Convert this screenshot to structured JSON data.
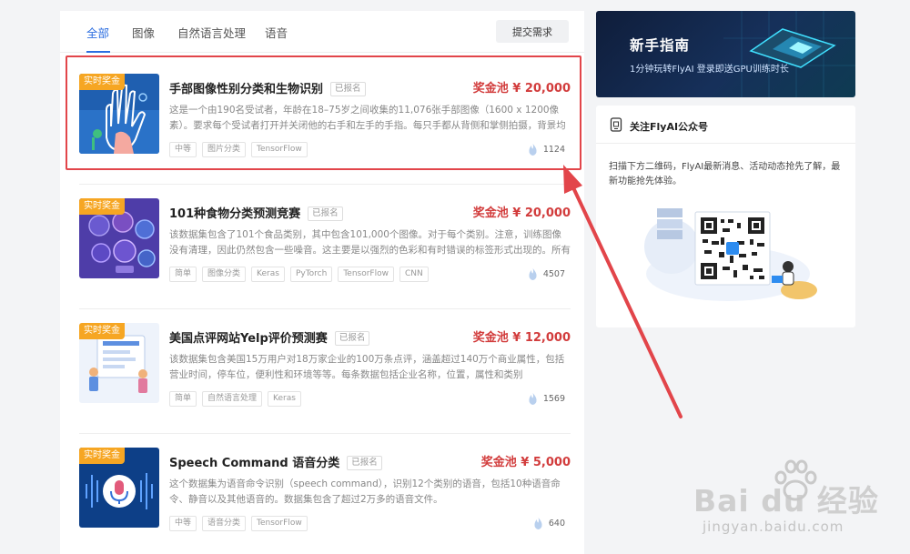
{
  "tabs": [
    {
      "label": "全部",
      "active": true
    },
    {
      "label": "图像",
      "active": false
    },
    {
      "label": "自然语言处理",
      "active": false
    },
    {
      "label": "语音",
      "active": false
    }
  ],
  "submit_label": "提交需求",
  "competitions": [
    {
      "badge": "实时奖金",
      "title": "手部图像性别分类和生物识别",
      "status": "已报名",
      "prize": "奖金池 ¥ 20,000",
      "description": "这是一个由190名受试者，年龄在18–75岁之间收集的11,076张手部图像（1600 x 1200像素）。要求每个受试者打开并关闭他的右手和左手的手指。每只手都从背侧和掌侧拍摄，背景均匀，并与…",
      "tags": [
        "中等",
        "图片分类",
        "TensorFlow"
      ],
      "views": "1124",
      "highlighted": true
    },
    {
      "badge": "实时奖金",
      "title": "101种食物分类预测竞赛",
      "status": "已报名",
      "prize": "奖金池 ¥ 20,000",
      "description": "该数据集包含了101个食品类别，其中包含101,000个图像。对于每个类别。注意，训练图像没有清理，因此仍然包含一些噪音。这主要是以强烈的色彩和有时错误的标签形式出现的。所有图像都…",
      "tags": [
        "简单",
        "图像分类",
        "Keras",
        "PyTorch",
        "TensorFlow",
        "CNN"
      ],
      "views": "4507",
      "highlighted": false
    },
    {
      "badge": "实时奖金",
      "title": "美国点评网站Yelp评价预测赛",
      "status": "已报名",
      "prize": "奖金池 ¥ 12,000",
      "description": "该数据集包含美国15万用户对18万家企业的100万条点评，涵盖超过140万个商业属性，包括营业时间，停车位，便利性和环境等等。每条数据包括企业名称，位置，属性和类别",
      "tags": [
        "简单",
        "自然语言处理",
        "Keras"
      ],
      "views": "1569",
      "highlighted": false
    },
    {
      "badge": "实时奖金",
      "title": "Speech Command 语音分类",
      "status": "已报名",
      "prize": "奖金池 ¥ 5,000",
      "description": "这个数据集为语音命令识别（speech command），识别12个类别的语音，包括10种语音命令、静音以及其他语音的。数据集包含了超过2万多的语音文件。",
      "tags": [
        "中等",
        "语音分类",
        "TensorFlow"
      ],
      "views": "640",
      "highlighted": false
    }
  ],
  "banner": {
    "title": "新手指南",
    "subtitle": "1分钟玩转FlyAI 登录即送GPU训练时长"
  },
  "wechat": {
    "title": "关注FlyAI公众号",
    "text": "扫描下方二维码，FlyAI最新消息、活动动态抢先了解，最新功能抢先体验。"
  },
  "watermark": {
    "brand": "Bai du 经验",
    "url": "jingyan.baidu.com"
  },
  "colors": {
    "accent": "#2b6de0",
    "prize": "#d23c3c",
    "badge": "#f6a623",
    "highlight": "#e2454a"
  }
}
